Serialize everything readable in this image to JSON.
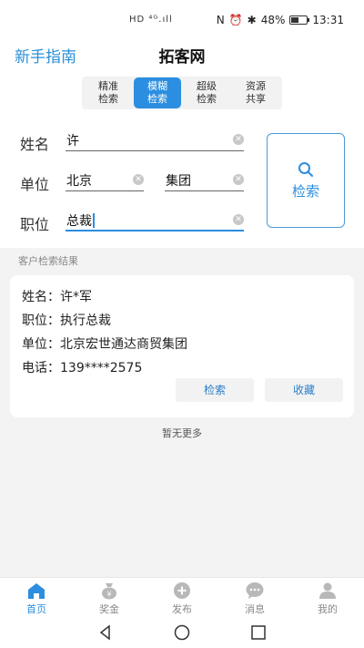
{
  "status_bar": {
    "left_icons": "HD ⁴ᴳ.ıll",
    "battery": "48%",
    "time": "13:31"
  },
  "header": {
    "guide_link": "新手指南",
    "title": "拓客网"
  },
  "mode_tabs": [
    {
      "line1": "精准",
      "line2": "检索",
      "active": false
    },
    {
      "line1": "模糊",
      "line2": "检索",
      "active": true
    },
    {
      "line1": "超级",
      "line2": "检索",
      "active": false
    },
    {
      "line1": "资源",
      "line2": "共享",
      "active": false
    }
  ],
  "form": {
    "name_label": "姓名",
    "name_value": "许",
    "unit_label": "单位",
    "unit_city": "北京",
    "unit_company": "集团",
    "position_label": "职位",
    "position_value": "总裁",
    "search_button": "检索"
  },
  "results_caption": "客户检索结果",
  "result": {
    "name": "姓名：许*军",
    "position": "职位：执行总裁",
    "unit": "单位：北京宏世通达商贸集团",
    "phone": "电话：139****2575",
    "search_btn": "检索",
    "favorite_btn": "收藏"
  },
  "no_more": "暂无更多",
  "tabs": [
    {
      "label": "首页",
      "icon": "home-icon",
      "active": true
    },
    {
      "label": "奖金",
      "icon": "money-bag-icon",
      "active": false
    },
    {
      "label": "发布",
      "icon": "plus-circle-icon",
      "active": false
    },
    {
      "label": "消息",
      "icon": "chat-icon",
      "active": false
    },
    {
      "label": "我的",
      "icon": "user-icon",
      "active": false
    }
  ],
  "colors": {
    "accent": "#2b8ee0",
    "inactive": "#b8b8b8"
  }
}
